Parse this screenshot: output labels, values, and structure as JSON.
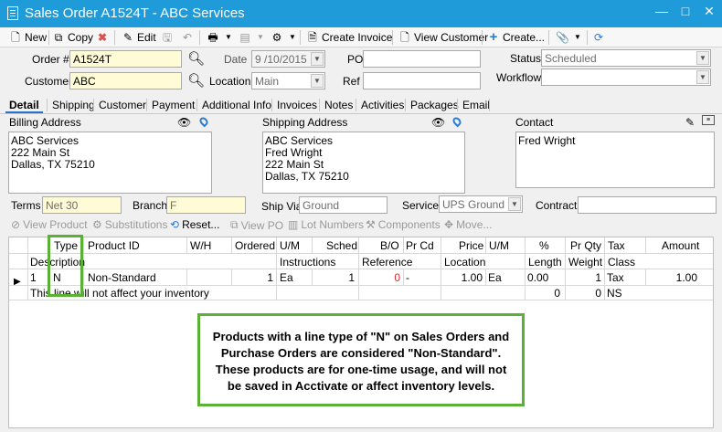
{
  "window": {
    "title": "Sales Order A1524T - ABC Services",
    "minimize": "—",
    "maximize": "□",
    "close": "✕"
  },
  "toolbar": {
    "new": "New",
    "copy": "Copy",
    "edit": "Edit",
    "create_invoice": "Create Invoice",
    "view_customer": "View Customer",
    "create": "Create..."
  },
  "form": {
    "order_label": "Order #",
    "order_value": "A1524T",
    "date_label": "Date",
    "date_value": "9 /10/2015",
    "po_label": "PO",
    "po_value": "",
    "status_label": "Status",
    "status_value": "Scheduled",
    "customer_label": "Customer",
    "customer_value": "ABC",
    "location_label": "Location",
    "location_value": "Main",
    "ref_label": "Ref",
    "ref_value": "",
    "workflow_label": "Workflow",
    "workflow_value": ""
  },
  "tabs": [
    "Detail",
    "Shipping",
    "Customer",
    "Payment",
    "Additional Info",
    "Invoices",
    "Notes",
    "Activities",
    "Packages",
    "Email"
  ],
  "billing": {
    "label": "Billing Address",
    "text": "ABC Services\n222 Main St\nDallas, TX 75210"
  },
  "shipping": {
    "label": "Shipping Address",
    "text": "ABC Services\nFred Wright\n222 Main St\nDallas, TX 75210"
  },
  "contact": {
    "label": "Contact",
    "text": "Fred Wright"
  },
  "terms": {
    "terms_label": "Terms",
    "terms_value": "Net 30",
    "branch_label": "Branch",
    "branch_value": "F",
    "shipvia_label": "Ship Via",
    "shipvia_value": "Ground",
    "service_label": "Service",
    "service_value": "UPS Ground",
    "contract_label": "Contract",
    "contract_value": ""
  },
  "actions": {
    "view_product": "View Product",
    "substitutions": "Substitutions",
    "reset": "Reset...",
    "view_po": "View PO",
    "lot_numbers": "Lot Numbers",
    "components": "Components",
    "move": "Move..."
  },
  "grid": {
    "header1": {
      "type": "Type",
      "product_id": "Product ID",
      "wh": "W/H",
      "ordered": "Ordered",
      "um": "U/M",
      "sched": "Sched",
      "bo": "B/O",
      "pr_cd": "Pr Cd",
      "price": "Price",
      "um2": "U/M",
      "pct": "%",
      "pr_qty": "Pr Qty",
      "tax": "Tax",
      "amount": "Amount"
    },
    "header2": {
      "description": "Description",
      "instructions": "Instructions",
      "reference": "Reference",
      "location": "Location",
      "length": "Length",
      "weight": "Weight",
      "class": "Class"
    },
    "row1": {
      "line": "1",
      "type": "N",
      "product": "Non-Standard",
      "ordered": "1",
      "um": "Ea",
      "sched": "1",
      "bo": "0",
      "pr_cd": "-",
      "price": "1.00",
      "um2": "Ea",
      "pct": "0.00",
      "pr_qty": "1",
      "tax": "Tax",
      "amount": "1.00"
    },
    "row2": {
      "description": "This line will not affect your inventory",
      "length": "0",
      "weight": "0",
      "class": "NS"
    }
  },
  "note": {
    "line1": "Products with a line type of \"N\" on Sales Orders and",
    "line2": "Purchase Orders are considered \"Non-Standard\".",
    "line3": "These products are for one-time usage, and will not",
    "line4": "be saved in Acctivate or affect inventory levels."
  },
  "colors": {
    "titlebar": "#1e9bd8",
    "highlight": "#5bb135",
    "required_field": "#fffbd6"
  }
}
